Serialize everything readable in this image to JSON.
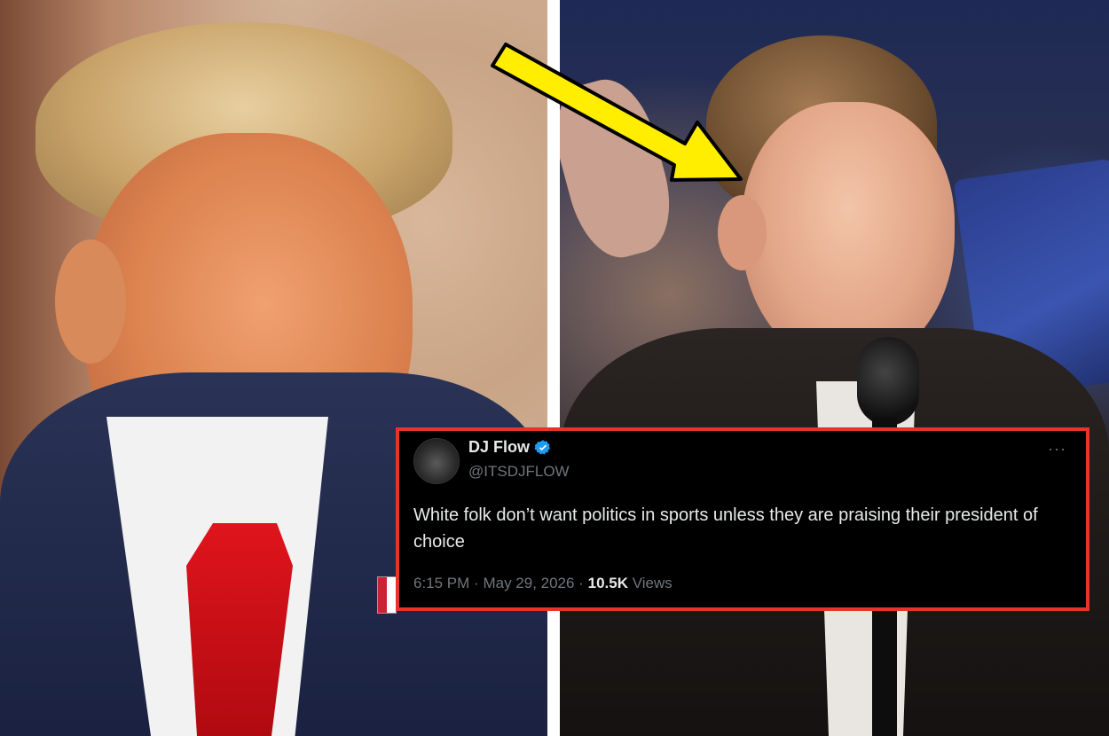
{
  "tweet": {
    "display_name": "DJ Flow",
    "handle": "@ITSDJFLOW",
    "more_label": "···",
    "text": "White folk don’t want politics in sports unless they are praising their president of choice",
    "time": "6:15 PM",
    "separator": "·",
    "date": "May 29, 2026",
    "views_count": "10.5K",
    "views_label": "Views",
    "verified_icon": "verified-badge-icon",
    "avatar_icon": "avatar-icon"
  },
  "colors": {
    "tweet_border": "#e8322b",
    "tweet_background": "#000000",
    "arrow": "#ffee00",
    "verified": "#1d9bf0"
  }
}
